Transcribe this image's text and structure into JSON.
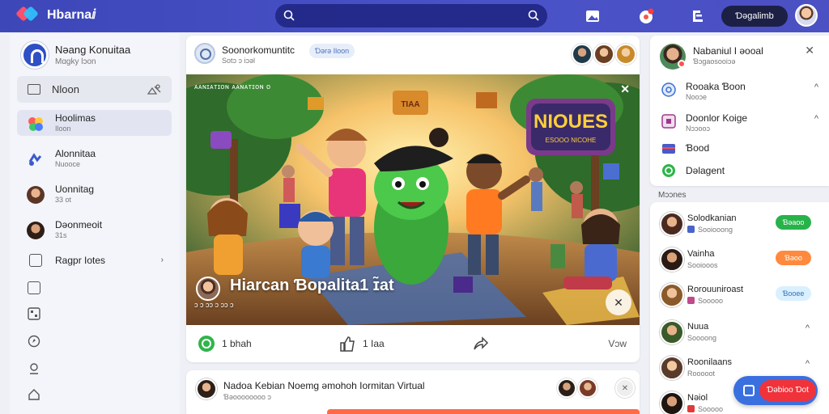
{
  "app": {
    "name": "Hbarnaⅈ"
  },
  "topbar": {
    "search_placeholder": "",
    "button_label": "Ɗəgalimb",
    "notification_badge": "•"
  },
  "sidebar": {
    "profile_name": "Nəang Konuitaa",
    "profile_sub": "Mɑgky lɔon",
    "search_label": "Nloon",
    "items": [
      {
        "label": "Hoolimas",
        "sub": "Iloon"
      },
      {
        "label": "Alonnitaa",
        "sub": "Nuooce"
      },
      {
        "label": "Uonnitag",
        "sub": "33 ot"
      },
      {
        "label": "Dəonmeoit",
        "sub": "31s"
      },
      {
        "label": "Ragpr Iotes"
      }
    ]
  },
  "post": {
    "title": "Soonorkomuntitc",
    "subtitle": "Sotɔ ɔ iɔəl",
    "tag": "Ɗərə Iloon",
    "banner_tiny": "ᴀᴀɴɪᴀᴛɪᴏɴ ᴀᴀɴᴀᴛɪᴏɴ ᴏ",
    "banner_sign": "NIOUES",
    "banner_sign_sub": "ESOOO NICOHE",
    "banner_plaque": "TIAA",
    "banner_title": "Hiarcan Ɓopalita1 ɪ̃at",
    "banner_meta": "ɔ ɔ ɔɔ  ɔ ɔɔ ɔ",
    "actions": {
      "like": "1 bhah",
      "comment": "1 Iaa",
      "view": "Vɔw"
    }
  },
  "post2": {
    "title": "Nadoa Kebian Noemg əmohoh Iormitan Virtual",
    "sub": "Ɓəoooooooo ɔ"
  },
  "right_panel": {
    "title": "Nabaniul I əooal",
    "sub": "Ɓɔgaosooiɔə",
    "items": [
      {
        "label": "Rooaka Ɓoon",
        "sub": "Nooɔe"
      },
      {
        "label": "Doonlor Koige",
        "sub": "Nɔɔooɔ"
      },
      {
        "label": "Ɓood"
      },
      {
        "label": "Dəlagent"
      }
    ]
  },
  "section_label": "Mɔɔnes",
  "people": [
    {
      "name": "Solodkanian",
      "sub": "Sooiooong",
      "button": "Ɓəaoo",
      "button_color": "#27b34a"
    },
    {
      "name": "Vainha",
      "sub": "Sooiooos",
      "button": "Ɓəoo",
      "button_color": "#ff8a3d"
    },
    {
      "name": "Rorouuniroast",
      "sub": "Sooooo",
      "button": "Ɓooee",
      "button_color": "#d9f0ff"
    },
    {
      "name": "Nuua",
      "sub": "Soooong"
    },
    {
      "name": "Roonilaans",
      "sub": "Rooooot"
    },
    {
      "name": "Nəiol",
      "sub": "Sooooo"
    }
  ],
  "float_button": {
    "label": "Ɗəbioo Ɗot"
  }
}
